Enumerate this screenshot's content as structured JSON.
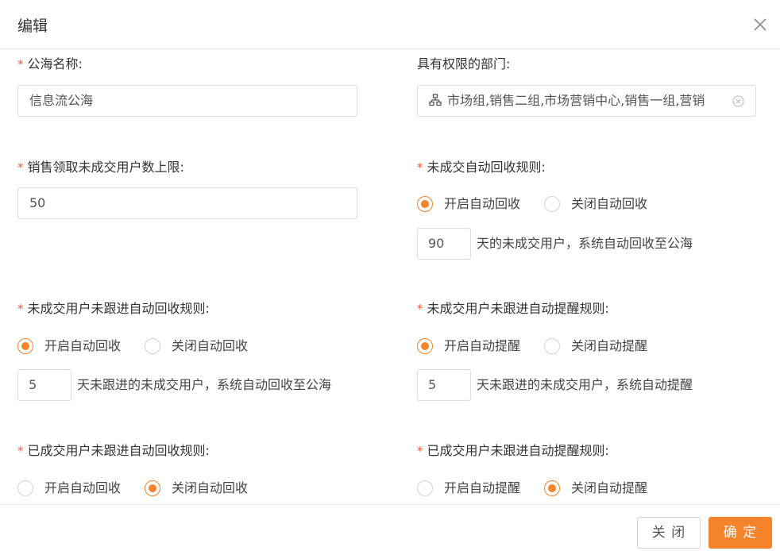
{
  "dialog": {
    "title": "编辑",
    "close_icon": "close-icon"
  },
  "form": {
    "pool_name": {
      "required": "*",
      "label": "公海名称:",
      "value": "信息流公海"
    },
    "departments": {
      "label": "具有权限的部门:",
      "value": "市场组,销售二组,市场营销中心,销售一组,营销",
      "icon": "org-tree-icon",
      "clear_icon": "clear-circle-icon"
    },
    "claim_limit": {
      "required": "*",
      "label": "销售领取未成交用户数上限:",
      "value": "50"
    },
    "auto_recycle": {
      "required": "*",
      "label": "未成交自动回收规则:",
      "option_on": "开启自动回收",
      "option_off": "关闭自动回收",
      "selected": "on",
      "days": "90",
      "suffix": "天的未成交用户，系统自动回收至公海"
    },
    "no_followup_recycle": {
      "required": "*",
      "label": "未成交用户未跟进自动回收规则:",
      "option_on": "开启自动回收",
      "option_off": "关闭自动回收",
      "selected": "on",
      "days": "5",
      "suffix": "天未跟进的未成交用户，系统自动回收至公海"
    },
    "no_followup_remind": {
      "required": "*",
      "label": "未成交用户未跟进自动提醒规则:",
      "option_on": "开启自动提醒",
      "option_off": "关闭自动提醒",
      "selected": "on",
      "days": "5",
      "suffix": "天未跟进的未成交用户，系统自动提醒"
    },
    "dealt_recycle": {
      "required": "*",
      "label": "已成交用户未跟进自动回收规则:",
      "option_on": "开启自动回收",
      "option_off": "关闭自动回收",
      "selected": "off"
    },
    "dealt_remind": {
      "required": "*",
      "label": "已成交用户未跟进自动提醒规则:",
      "option_on": "开启自动提醒",
      "option_off": "关闭自动提醒",
      "selected": "off"
    }
  },
  "footer": {
    "cancel_label": "关 闭",
    "ok_label": "确 定"
  },
  "colors": {
    "accent": "#f5832a",
    "required": "#f05a3a",
    "border": "#dcdcdc"
  }
}
